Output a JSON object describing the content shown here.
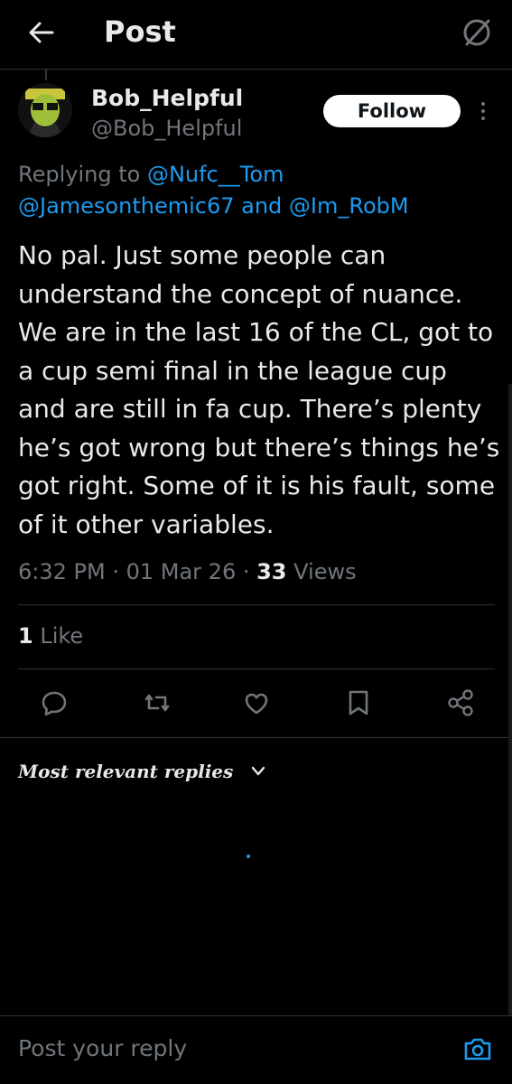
{
  "header": {
    "title": "Post"
  },
  "post": {
    "display_name": "Bob_Helpful",
    "handle": "@Bob_Helpful",
    "follow_label": "Follow",
    "replying_prefix": "Replying to ",
    "mention_1": "@Nufc__Tom",
    "mention_2": "@Jamesonthemic67",
    "replying_and": " and ",
    "mention_3": "@Im_RobM",
    "text": "No pal. Just some people can understand the concept of nuance. We are in the last 16 of the CL, got to a cup semi final in the league cup and are still in fa cup. There’s plenty he’s got wrong but there’s things he’s got right. Some of it is his fault, some of it other variables.",
    "time": "6:32 PM",
    "sep1": " · ",
    "date": "01 Mar 26",
    "sep2": " · ",
    "views_count": "33",
    "views_label": " Views",
    "likes_count": "1",
    "likes_label": " Like"
  },
  "actions": [
    "reply-icon",
    "repost-icon",
    "like-icon",
    "bookmark-icon",
    "share-icon"
  ],
  "replies": {
    "sort_label": "Most relevant replies"
  },
  "composer": {
    "placeholder": "Post your reply"
  },
  "colors": {
    "accent": "#1d9bf0",
    "background": "#000000",
    "divider": "#2f3336",
    "muted": "#71767b"
  }
}
